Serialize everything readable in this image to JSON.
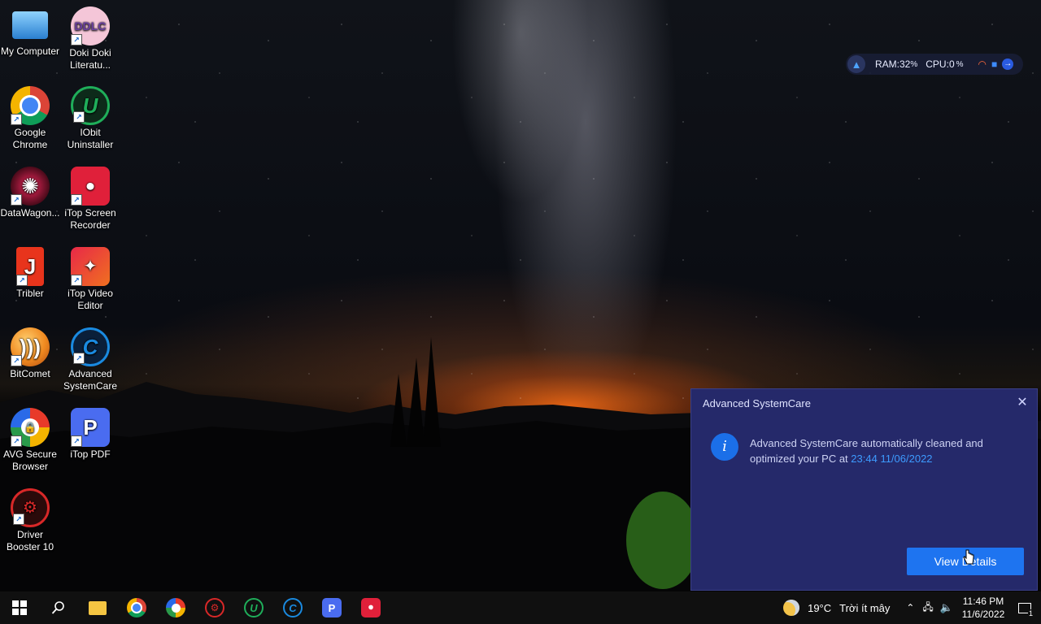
{
  "desktop": {
    "icons": [
      {
        "label": "My Computer",
        "icon": "computer-icon",
        "color": "#3a8fdc"
      },
      {
        "label": "Doki Doki Literatu...",
        "icon": "doki-doki-icon",
        "color": "#f2a8c8"
      },
      {
        "label": "Google Chrome",
        "icon": "chrome-icon",
        "color": "#db4437"
      },
      {
        "label": "IObit Uninstaller",
        "icon": "iobit-uninstaller-icon",
        "color": "#1fae5a"
      },
      {
        "label": "DataWagon...",
        "icon": "datawagon-icon",
        "color": "#c0204a"
      },
      {
        "label": "iTop Screen Recorder",
        "icon": "itop-screen-recorder-icon",
        "color": "#e0203a"
      },
      {
        "label": "Tribler",
        "icon": "tribler-icon",
        "color": "#e8341c"
      },
      {
        "label": "iTop Video Editor",
        "icon": "itop-video-editor-icon",
        "color": "#e82848"
      },
      {
        "label": "BitComet",
        "icon": "bitcomet-icon",
        "color": "#f08a20"
      },
      {
        "label": "Advanced SystemCare",
        "icon": "advanced-systemcare-icon",
        "color": "#1a8ae0"
      },
      {
        "label": "AVG Secure Browser",
        "icon": "avg-secure-browser-icon",
        "color": "#e83a2a"
      },
      {
        "label": "iTop PDF",
        "icon": "itop-pdf-icon",
        "color": "#4a6cf0"
      },
      {
        "label": "Driver Booster 10",
        "icon": "driver-booster-icon",
        "color": "#d82828"
      }
    ]
  },
  "monitor": {
    "ram_label": "RAM:",
    "ram_value": "32",
    "cpu_label": "CPU:",
    "cpu_value": "0",
    "unit": "%"
  },
  "notification": {
    "title": "Advanced SystemCare",
    "message_prefix": "Advanced SystemCare automatically cleaned and optimized your PC at",
    "message_time": "23:44 11/06/2022",
    "button_label": "View Details",
    "info_glyph": "i",
    "close_glyph": "✕"
  },
  "taskbar": {
    "pinned": [
      "start-icon",
      "search-icon",
      "file-explorer-icon",
      "chrome-icon",
      "avg-browser-icon",
      "driver-booster-icon",
      "iobit-uninstaller-icon",
      "advanced-systemcare-icon",
      "itop-pdf-icon",
      "itop-screen-recorder-icon"
    ],
    "weather_temp": "19°C",
    "weather_text": "Trời ít mây",
    "time": "11:46 PM",
    "date": "11/6/2022",
    "notification_count": "1"
  }
}
